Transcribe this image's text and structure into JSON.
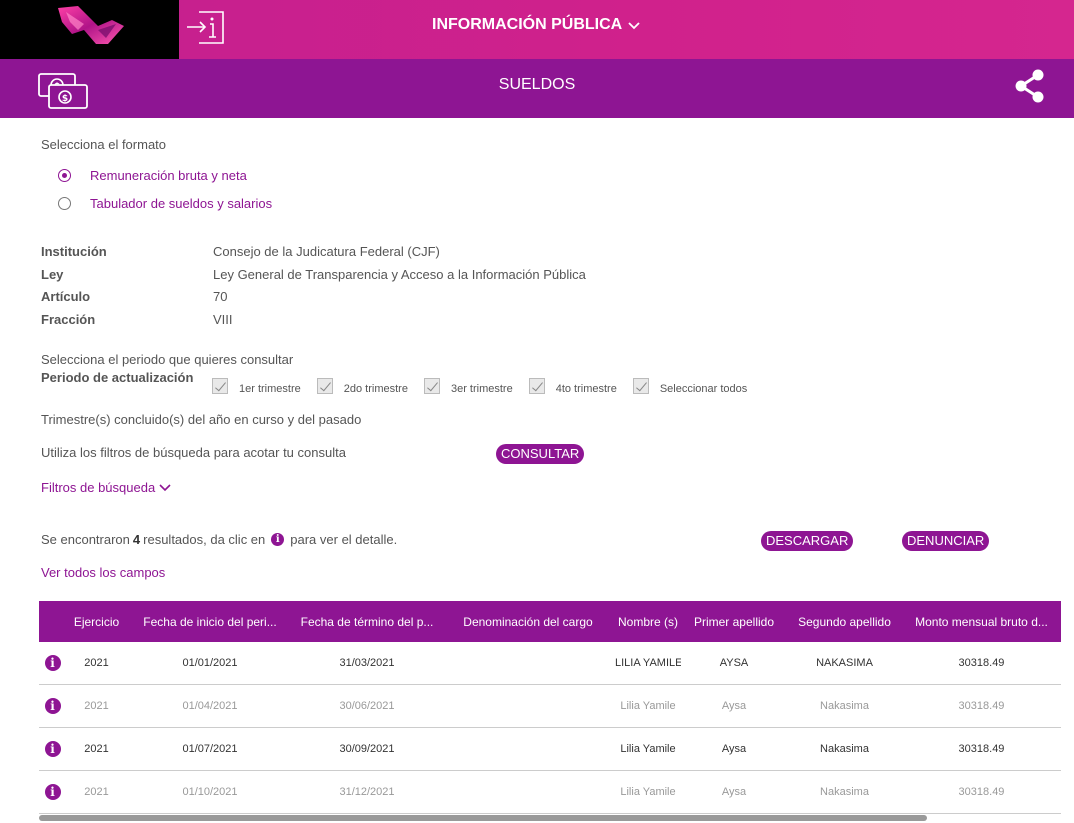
{
  "header": {
    "menu_label": "INFORMACIÓN PÚBLICA",
    "section_title": "SUELDOS"
  },
  "formato": {
    "prompt": "Selecciona el formato",
    "options": [
      "Remuneración bruta y neta",
      "Tabulador de sueldos y salarios"
    ],
    "selected_index": 0
  },
  "info": {
    "rows": [
      {
        "key": "Institución",
        "value": "Consejo de la Judicatura Federal (CJF)"
      },
      {
        "key": "Ley",
        "value": "Ley General de Transparencia y Acceso a la Información Pública"
      },
      {
        "key": "Artículo",
        "value": "70"
      },
      {
        "key": "Fracción",
        "value": "VIII"
      }
    ]
  },
  "periodo": {
    "prompt": "Selecciona el periodo que quieres consultar",
    "label": "Periodo de actualización",
    "options": [
      "1er trimestre",
      "2do trimestre",
      "3er trimestre",
      "4to trimestre",
      "Seleccionar todos"
    ],
    "note": "Trimestre(s) concluido(s) del año en curso y del pasado"
  },
  "consulta": {
    "prompt": "Utiliza los filtros de búsqueda para acotar tu consulta",
    "button": "CONSULTAR",
    "filters_label": "Filtros de búsqueda"
  },
  "resultados": {
    "prefix": "Se encontraron",
    "count": "4",
    "middle": "resultados, da clic en",
    "suffix": "para ver el detalle.",
    "download_button": "DESCARGAR",
    "report_button": "DENUNCIAR",
    "ver_todos": "Ver todos los campos"
  },
  "table": {
    "headers": [
      "Ejercicio",
      "Fecha de inicio del peri...",
      "Fecha de término del p...",
      "Denominación del cargo",
      "Nombre (s)",
      "Primer apellido",
      "Segundo apellido",
      "Monto mensual bruto d..."
    ],
    "rows": [
      [
        "2021",
        "01/01/2021",
        "31/03/2021",
        "",
        "LILIA YAMILE",
        "AYSA",
        "NAKASIMA",
        "30318.49"
      ],
      [
        "2021",
        "01/04/2021",
        "30/06/2021",
        "",
        "Lilia Yamile",
        "Aysa",
        "Nakasima",
        "30318.49"
      ],
      [
        "2021",
        "01/07/2021",
        "30/09/2021",
        "",
        "Lilia Yamile",
        "Aysa",
        "Nakasima",
        "30318.49"
      ],
      [
        "2021",
        "01/10/2021",
        "31/12/2021",
        "",
        "Lilia Yamile",
        "Aysa",
        "Nakasima",
        "30318.49"
      ]
    ]
  },
  "colors": {
    "magenta": "#d0218c",
    "purple": "#8e1593"
  },
  "icons": {
    "logo": "ribbon-logo",
    "login": "login-info-icon",
    "money": "money-bills-icon",
    "share": "share-icon",
    "info": "info-icon"
  }
}
